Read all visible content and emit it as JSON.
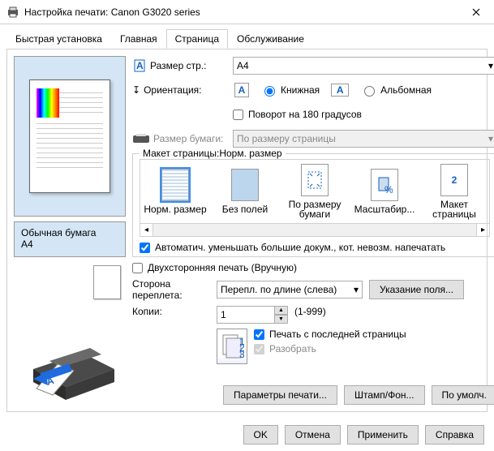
{
  "window": {
    "title": "Настройка печати: Canon G3020 series"
  },
  "tabs": [
    "Быстрая установка",
    "Главная",
    "Страница",
    "Обслуживание"
  ],
  "active_tab": 2,
  "preview": {
    "paper_type": "Обычная бумага",
    "paper_size": "A4"
  },
  "page_size": {
    "label": "Размер стр.:",
    "value": "A4"
  },
  "orientation": {
    "label": "Ориентация:",
    "portrait": "Книжная",
    "landscape": "Альбомная",
    "selected": "portrait",
    "rotate180": "Поворот на 180 градусов",
    "rotate_checked": false
  },
  "paper_printer": {
    "label": "Размер бумаги:",
    "value": "По размеру страницы",
    "disabled": true
  },
  "layout_group": {
    "title": "Макет страницы:",
    "current": "Норм. размер",
    "items": [
      {
        "label": "Норм. размер",
        "key": "normal"
      },
      {
        "label": "Без полей",
        "key": "borderless"
      },
      {
        "label": "По размеру бумаги",
        "key": "fit"
      },
      {
        "label": "Масштабир...",
        "key": "scaled"
      },
      {
        "label": "Макет страницы",
        "key": "layout"
      }
    ],
    "selected": 0,
    "auto_reduce": "Автоматич. уменьшать большие докум., кот. невозм. напечатать",
    "auto_reduce_checked": true
  },
  "duplex": {
    "label": "Двухсторонняя печать (Вручную)",
    "checked": false
  },
  "binding": {
    "label": "Сторона переплета:",
    "value": "Перепл. по длине (слева)",
    "margin_btn": "Указание поля..."
  },
  "copies": {
    "label": "Копии:",
    "value": "1",
    "range": "(1-999)",
    "last_first": "Печать с последней страницы",
    "last_first_checked": true,
    "collate": "Разобрать",
    "collate_checked": true,
    "collate_disabled": true
  },
  "bottom_btns": {
    "print_options": "Параметры печати...",
    "stamp": "Штамп/Фон...",
    "defaults": "По умолч."
  },
  "dialog_btns": {
    "ok": "OK",
    "cancel": "Отмена",
    "apply": "Применить",
    "help": "Справка"
  }
}
